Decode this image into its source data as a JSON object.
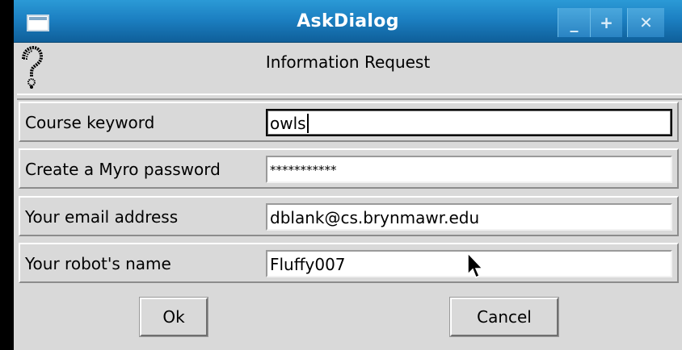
{
  "window": {
    "title": "AskDialog",
    "menu_icon": "window-menu-icon",
    "controls": {
      "minimize": "_",
      "maximize": "+",
      "close": "✕"
    }
  },
  "header": {
    "icon": "question-mark-icon",
    "label": "Information Request"
  },
  "form": {
    "fields": [
      {
        "label": "Course keyword",
        "value": "owls",
        "focused": true
      },
      {
        "label": "Create a Myro password",
        "value": "***********",
        "masked": true
      },
      {
        "label": "Your email address",
        "value": "dblank@cs.brynmawr.edu"
      },
      {
        "label": "Your robot's name",
        "value": "Fluffy007"
      }
    ]
  },
  "buttons": {
    "ok": "Ok",
    "cancel": "Cancel"
  },
  "colors": {
    "titlebar": "#1c80c2",
    "dialog_bg": "#d9d9d9",
    "entry_bg": "#ffffff"
  }
}
